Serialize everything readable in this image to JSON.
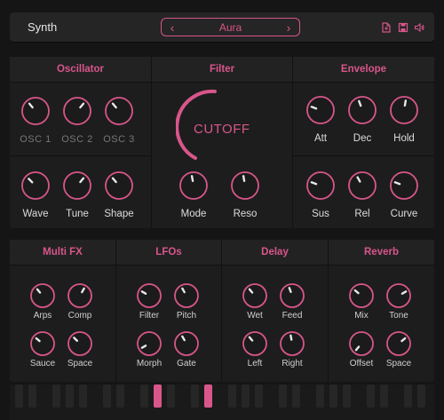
{
  "app": {
    "title": "Synth"
  },
  "preset": {
    "name": "Aura",
    "prev_icon": "chevron-left-icon",
    "next_icon": "chevron-right-icon"
  },
  "toolbar": {
    "icons": [
      "file-icon",
      "save-icon",
      "speaker-icon"
    ]
  },
  "colors": {
    "accent": "#d8568a",
    "background": "#151515",
    "panel": "#1d1d1d"
  },
  "sections": {
    "oscillator": {
      "title": "Oscillator",
      "osc_labels": [
        "OSC 1",
        "OSC 2",
        "OSC 3"
      ],
      "knobs": [
        "Wave",
        "Tune",
        "Shape"
      ]
    },
    "filter": {
      "title": "Filter",
      "cutoff": "CUTOFF",
      "knobs": [
        "Mode",
        "Reso"
      ]
    },
    "envelope": {
      "title": "Envelope",
      "knobs": [
        "Att",
        "Dec",
        "Hold",
        "Sus",
        "Rel",
        "Curve"
      ]
    },
    "multifx": {
      "title": "Multi FX",
      "knobs": [
        "Arps",
        "Comp",
        "Sauce",
        "Space"
      ]
    },
    "lfos": {
      "title": "LFOs",
      "knobs": [
        "Filter",
        "Pitch",
        "Morph",
        "Gate"
      ]
    },
    "delay": {
      "title": "Delay",
      "knobs": [
        "Wet",
        "Feed",
        "Left",
        "Right"
      ]
    },
    "reverb": {
      "title": "Reverb",
      "knobs": [
        "Mix",
        "Tone",
        "Offset",
        "Space"
      ]
    }
  },
  "keyboard": {
    "active_keys": [
      8,
      11
    ]
  }
}
